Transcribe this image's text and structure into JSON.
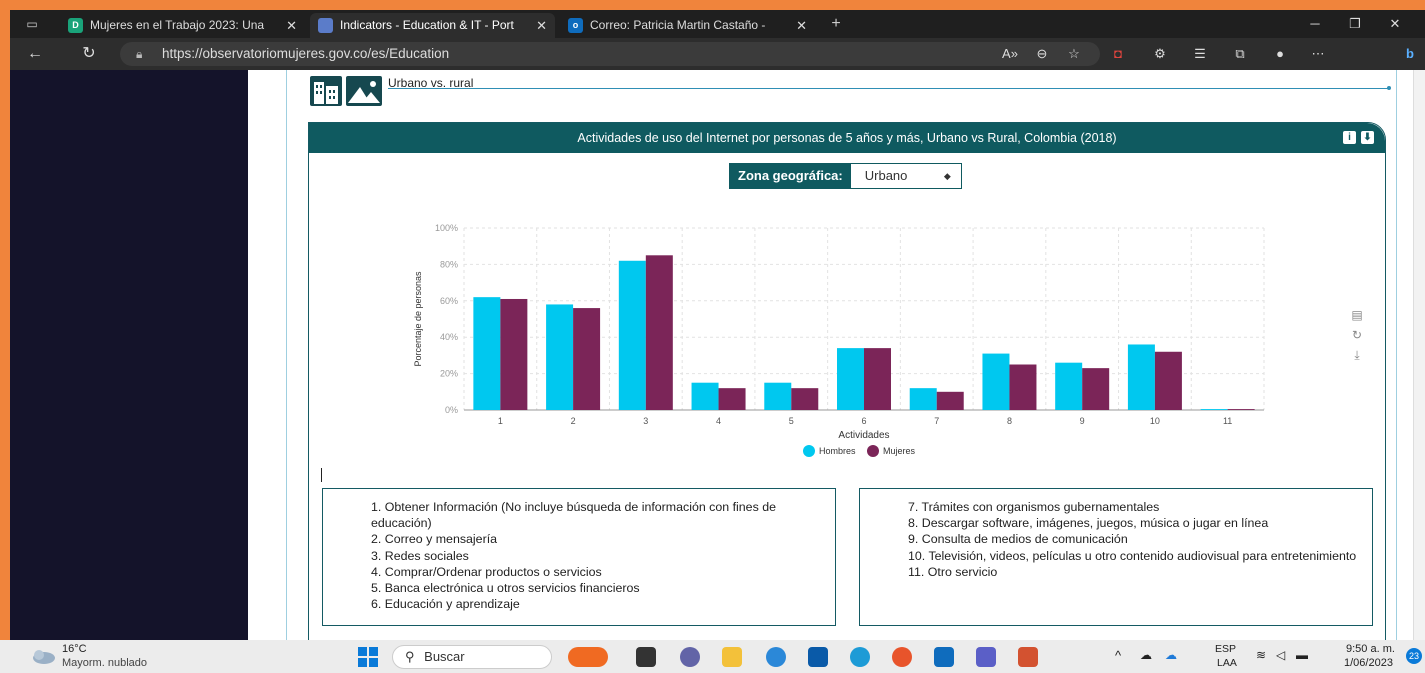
{
  "browser": {
    "tabs": [
      {
        "label": "Mujeres en el Trabajo 2023: Una",
        "favicon": "D",
        "favicon_color": "#1aa37a",
        "active": false
      },
      {
        "label": "Indicators - Education & IT - Port",
        "favicon": "",
        "favicon_color": "#5b7cc9",
        "active": true
      },
      {
        "label": "Correo: Patricia Martin Castaño -",
        "favicon": "o",
        "favicon_color": "#0f6cbd",
        "active": false
      }
    ],
    "url": "https://observatoriomujeres.gov.co/es/Education"
  },
  "section": {
    "title": "Urbano vs. rural"
  },
  "card": {
    "title": "Actividades de uso del Internet por personas de 5 años y más, Urbano vs Rural, Colombia (2018)",
    "filter_label": "Zona geográfica:",
    "filter_value": "Urbano"
  },
  "chart_data": {
    "type": "bar",
    "categories": [
      "1",
      "2",
      "3",
      "4",
      "5",
      "6",
      "7",
      "8",
      "9",
      "10",
      "11"
    ],
    "series": [
      {
        "name": "Hombres",
        "color": "#00c8ef",
        "values": [
          62,
          58,
          82,
          15,
          15,
          34,
          12,
          31,
          26,
          36,
          0.5
        ]
      },
      {
        "name": "Mujeres",
        "color": "#7b2558",
        "values": [
          61,
          56,
          85,
          12,
          12,
          34,
          10,
          25,
          23,
          32,
          0.5
        ]
      }
    ],
    "xlabel": "Actividades",
    "ylabel": "Porcentaje de personas",
    "ylim": [
      0,
      100
    ],
    "yticks": [
      "0%",
      "20%",
      "40%",
      "60%",
      "80%",
      "100%"
    ],
    "grid": true,
    "legend_position": "bottom"
  },
  "legend_left": [
    "1. Obtener Información (No incluye búsqueda de información con fines de educación)",
    "2. Correo y mensajería",
    "3. Redes sociales",
    "4. Comprar/Ordenar productos o servicios",
    "5. Banca electrónica u otros servicios financieros",
    "6. Educación y aprendizaje"
  ],
  "legend_right": [
    "7. Trámites con organismos gubernamentales",
    "8. Descargar software, imágenes, juegos, música o jugar en línea",
    "9. Consulta de medios de comunicación",
    "10. Televisión, videos, películas u otro contenido audiovisual para entretenimiento",
    "11. Otro servicio"
  ],
  "taskbar": {
    "weather_temp": "16°C",
    "weather_desc": "Mayorm. nublado",
    "search_label": "Buscar",
    "lang_top": "ESP",
    "lang_bottom": "LAA",
    "time": "9:50 a. m.",
    "date": "1/06/2023",
    "notif_count": "23"
  }
}
